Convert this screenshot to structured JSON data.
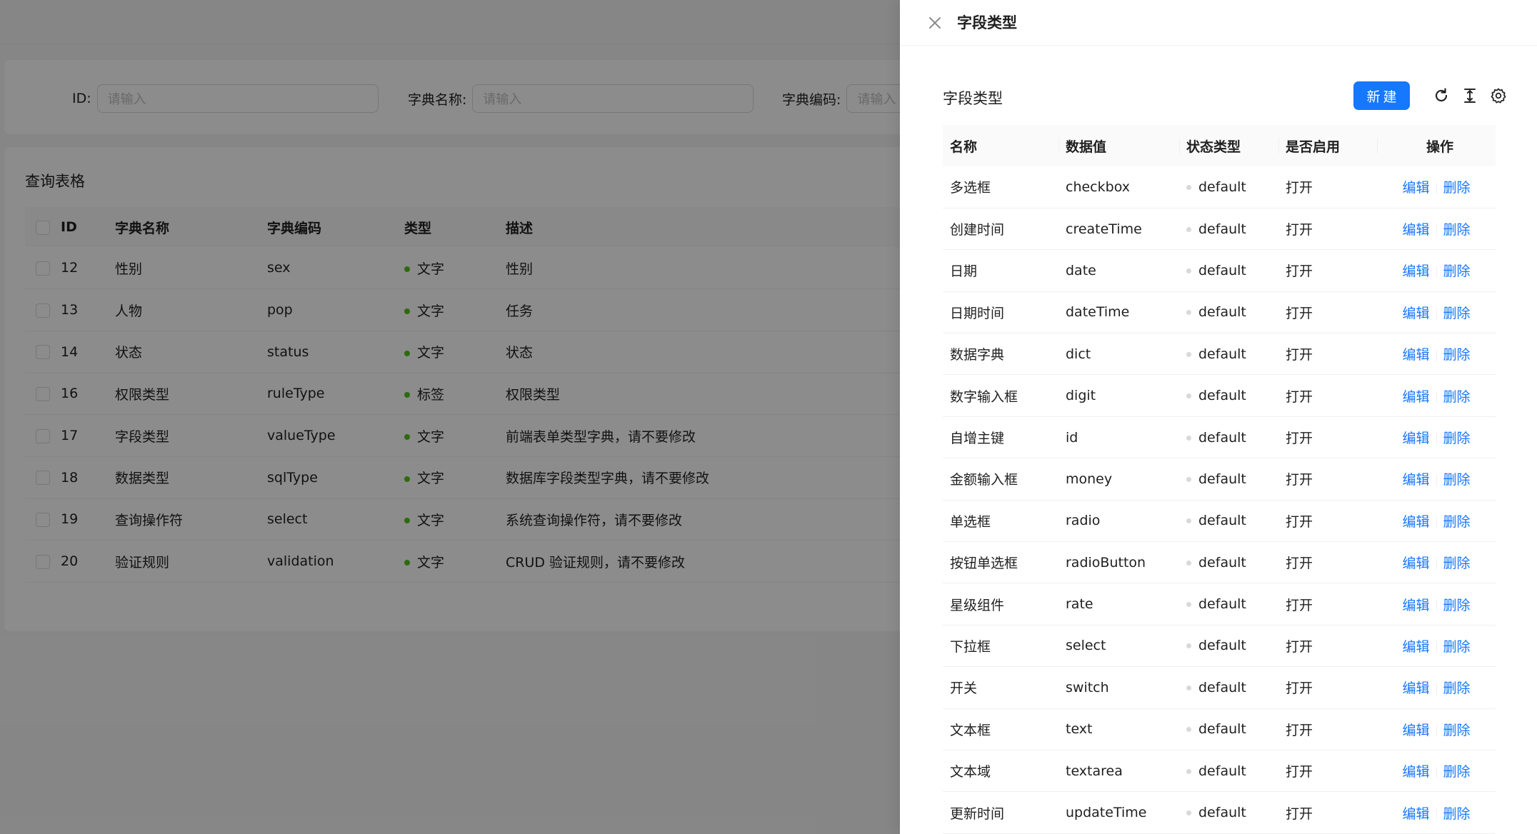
{
  "background": {
    "search": {
      "fields": [
        {
          "label": "ID:",
          "placeholder": "请输入"
        },
        {
          "label": "字典名称:",
          "placeholder": "请输入"
        },
        {
          "label": "字典编码:",
          "placeholder": "请输入"
        }
      ]
    },
    "table": {
      "title": "查询表格",
      "columns": [
        "ID",
        "字典名称",
        "字典编码",
        "类型",
        "描述"
      ],
      "rows": [
        {
          "id": "12",
          "name": "性别",
          "code": "sex",
          "type": "文字",
          "desc": "性别"
        },
        {
          "id": "13",
          "name": "人物",
          "code": "pop",
          "type": "文字",
          "desc": "任务"
        },
        {
          "id": "14",
          "name": "状态",
          "code": "status",
          "type": "文字",
          "desc": "状态"
        },
        {
          "id": "16",
          "name": "权限类型",
          "code": "ruleType",
          "type": "标签",
          "desc": "权限类型"
        },
        {
          "id": "17",
          "name": "字段类型",
          "code": "valueType",
          "type": "文字",
          "desc": "前端表单类型字典，请不要修改"
        },
        {
          "id": "18",
          "name": "数据类型",
          "code": "sqlType",
          "type": "文字",
          "desc": "数据库字段类型字典，请不要修改"
        },
        {
          "id": "19",
          "name": "查询操作符",
          "code": "select",
          "type": "文字",
          "desc": "系统查询操作符，请不要修改"
        },
        {
          "id": "20",
          "name": "验证规则",
          "code": "validation",
          "type": "文字",
          "desc": "CRUD 验证规则，请不要修改"
        }
      ]
    }
  },
  "drawer": {
    "title": "字段类型",
    "close_icon": "close-icon",
    "toolbar": {
      "title": "字段类型",
      "new_label": "新建",
      "icons": [
        "reload-icon",
        "column-height-icon",
        "setting-icon"
      ]
    },
    "table": {
      "columns": [
        "名称",
        "数据值",
        "状态类型",
        "是否启用",
        "操作"
      ],
      "edit_label": "编辑",
      "delete_label": "删除",
      "rows": [
        {
          "name": "多选框",
          "value": "checkbox",
          "status": "default",
          "enabled": "打开"
        },
        {
          "name": "创建时间",
          "value": "createTime",
          "status": "default",
          "enabled": "打开"
        },
        {
          "name": "日期",
          "value": "date",
          "status": "default",
          "enabled": "打开"
        },
        {
          "name": "日期时间",
          "value": "dateTime",
          "status": "default",
          "enabled": "打开"
        },
        {
          "name": "数据字典",
          "value": "dict",
          "status": "default",
          "enabled": "打开"
        },
        {
          "name": "数字输入框",
          "value": "digit",
          "status": "default",
          "enabled": "打开"
        },
        {
          "name": "自增主键",
          "value": "id",
          "status": "default",
          "enabled": "打开"
        },
        {
          "name": "金额输入框",
          "value": "money",
          "status": "default",
          "enabled": "打开"
        },
        {
          "name": "单选框",
          "value": "radio",
          "status": "default",
          "enabled": "打开"
        },
        {
          "name": "按钮单选框",
          "value": "radioButton",
          "status": "default",
          "enabled": "打开"
        },
        {
          "name": "星级组件",
          "value": "rate",
          "status": "default",
          "enabled": "打开"
        },
        {
          "name": "下拉框",
          "value": "select",
          "status": "default",
          "enabled": "打开"
        },
        {
          "name": "开关",
          "value": "switch",
          "status": "default",
          "enabled": "打开"
        },
        {
          "name": "文本框",
          "value": "text",
          "status": "default",
          "enabled": "打开"
        },
        {
          "name": "文本域",
          "value": "textarea",
          "status": "default",
          "enabled": "打开"
        },
        {
          "name": "更新时间",
          "value": "updateTime",
          "status": "default",
          "enabled": "打开"
        }
      ]
    }
  },
  "colors": {
    "primary": "#1677ff",
    "badge_success": "#52c41a",
    "badge_default": "#d9d9d9",
    "mask": "rgba(0,0,0,0.45)"
  }
}
